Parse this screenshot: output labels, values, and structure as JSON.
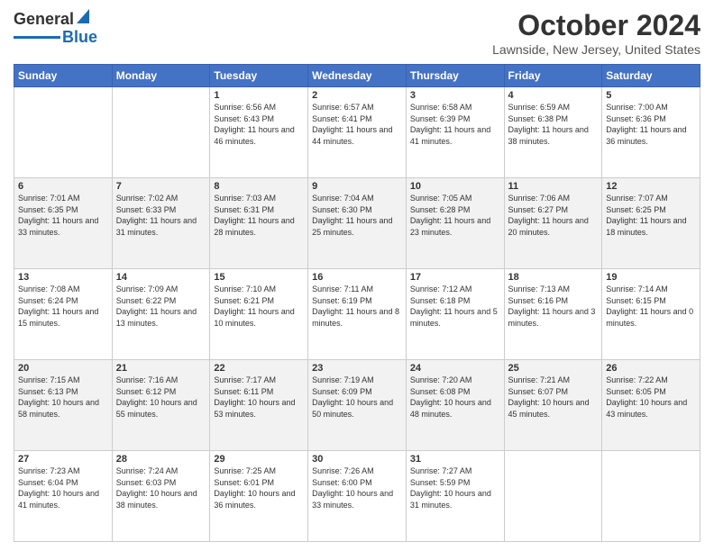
{
  "header": {
    "logo_line1": "General",
    "logo_line2": "Blue",
    "title": "October 2024",
    "subtitle": "Lawnside, New Jersey, United States"
  },
  "weekdays": [
    "Sunday",
    "Monday",
    "Tuesday",
    "Wednesday",
    "Thursday",
    "Friday",
    "Saturday"
  ],
  "weeks": [
    [
      {
        "day": "",
        "info": ""
      },
      {
        "day": "",
        "info": ""
      },
      {
        "day": "1",
        "info": "Sunrise: 6:56 AM\nSunset: 6:43 PM\nDaylight: 11 hours and 46 minutes."
      },
      {
        "day": "2",
        "info": "Sunrise: 6:57 AM\nSunset: 6:41 PM\nDaylight: 11 hours and 44 minutes."
      },
      {
        "day": "3",
        "info": "Sunrise: 6:58 AM\nSunset: 6:39 PM\nDaylight: 11 hours and 41 minutes."
      },
      {
        "day": "4",
        "info": "Sunrise: 6:59 AM\nSunset: 6:38 PM\nDaylight: 11 hours and 38 minutes."
      },
      {
        "day": "5",
        "info": "Sunrise: 7:00 AM\nSunset: 6:36 PM\nDaylight: 11 hours and 36 minutes."
      }
    ],
    [
      {
        "day": "6",
        "info": "Sunrise: 7:01 AM\nSunset: 6:35 PM\nDaylight: 11 hours and 33 minutes."
      },
      {
        "day": "7",
        "info": "Sunrise: 7:02 AM\nSunset: 6:33 PM\nDaylight: 11 hours and 31 minutes."
      },
      {
        "day": "8",
        "info": "Sunrise: 7:03 AM\nSunset: 6:31 PM\nDaylight: 11 hours and 28 minutes."
      },
      {
        "day": "9",
        "info": "Sunrise: 7:04 AM\nSunset: 6:30 PM\nDaylight: 11 hours and 25 minutes."
      },
      {
        "day": "10",
        "info": "Sunrise: 7:05 AM\nSunset: 6:28 PM\nDaylight: 11 hours and 23 minutes."
      },
      {
        "day": "11",
        "info": "Sunrise: 7:06 AM\nSunset: 6:27 PM\nDaylight: 11 hours and 20 minutes."
      },
      {
        "day": "12",
        "info": "Sunrise: 7:07 AM\nSunset: 6:25 PM\nDaylight: 11 hours and 18 minutes."
      }
    ],
    [
      {
        "day": "13",
        "info": "Sunrise: 7:08 AM\nSunset: 6:24 PM\nDaylight: 11 hours and 15 minutes."
      },
      {
        "day": "14",
        "info": "Sunrise: 7:09 AM\nSunset: 6:22 PM\nDaylight: 11 hours and 13 minutes."
      },
      {
        "day": "15",
        "info": "Sunrise: 7:10 AM\nSunset: 6:21 PM\nDaylight: 11 hours and 10 minutes."
      },
      {
        "day": "16",
        "info": "Sunrise: 7:11 AM\nSunset: 6:19 PM\nDaylight: 11 hours and 8 minutes."
      },
      {
        "day": "17",
        "info": "Sunrise: 7:12 AM\nSunset: 6:18 PM\nDaylight: 11 hours and 5 minutes."
      },
      {
        "day": "18",
        "info": "Sunrise: 7:13 AM\nSunset: 6:16 PM\nDaylight: 11 hours and 3 minutes."
      },
      {
        "day": "19",
        "info": "Sunrise: 7:14 AM\nSunset: 6:15 PM\nDaylight: 11 hours and 0 minutes."
      }
    ],
    [
      {
        "day": "20",
        "info": "Sunrise: 7:15 AM\nSunset: 6:13 PM\nDaylight: 10 hours and 58 minutes."
      },
      {
        "day": "21",
        "info": "Sunrise: 7:16 AM\nSunset: 6:12 PM\nDaylight: 10 hours and 55 minutes."
      },
      {
        "day": "22",
        "info": "Sunrise: 7:17 AM\nSunset: 6:11 PM\nDaylight: 10 hours and 53 minutes."
      },
      {
        "day": "23",
        "info": "Sunrise: 7:19 AM\nSunset: 6:09 PM\nDaylight: 10 hours and 50 minutes."
      },
      {
        "day": "24",
        "info": "Sunrise: 7:20 AM\nSunset: 6:08 PM\nDaylight: 10 hours and 48 minutes."
      },
      {
        "day": "25",
        "info": "Sunrise: 7:21 AM\nSunset: 6:07 PM\nDaylight: 10 hours and 45 minutes."
      },
      {
        "day": "26",
        "info": "Sunrise: 7:22 AM\nSunset: 6:05 PM\nDaylight: 10 hours and 43 minutes."
      }
    ],
    [
      {
        "day": "27",
        "info": "Sunrise: 7:23 AM\nSunset: 6:04 PM\nDaylight: 10 hours and 41 minutes."
      },
      {
        "day": "28",
        "info": "Sunrise: 7:24 AM\nSunset: 6:03 PM\nDaylight: 10 hours and 38 minutes."
      },
      {
        "day": "29",
        "info": "Sunrise: 7:25 AM\nSunset: 6:01 PM\nDaylight: 10 hours and 36 minutes."
      },
      {
        "day": "30",
        "info": "Sunrise: 7:26 AM\nSunset: 6:00 PM\nDaylight: 10 hours and 33 minutes."
      },
      {
        "day": "31",
        "info": "Sunrise: 7:27 AM\nSunset: 5:59 PM\nDaylight: 10 hours and 31 minutes."
      },
      {
        "day": "",
        "info": ""
      },
      {
        "day": "",
        "info": ""
      }
    ]
  ]
}
